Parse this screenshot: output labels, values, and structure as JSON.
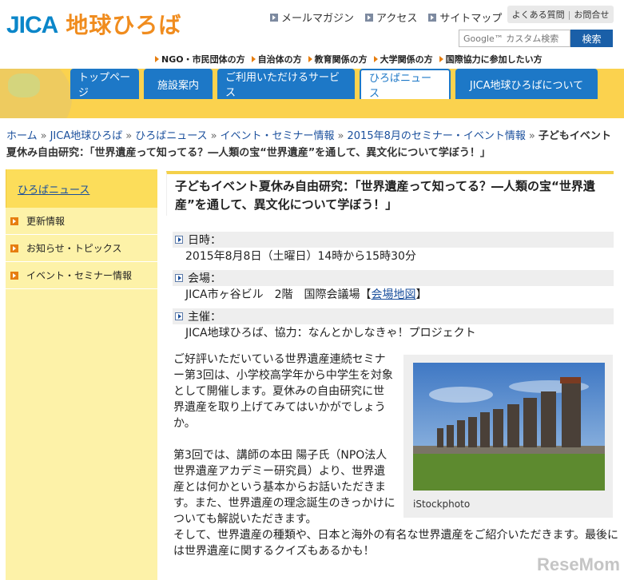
{
  "header": {
    "logo_en": "JICA",
    "logo_ja": "地球ひろば",
    "util_links": [
      "メールマガジン",
      "アクセス",
      "サイトマップ"
    ],
    "help": "よくある質問",
    "contact": "お問合せ",
    "search_placeholder": "Google™ カスタム検索",
    "search_button": "検索",
    "audience": [
      "NGO・市民団体の方",
      "自治体の方",
      "教育関係の方",
      "大学関係の方",
      "国際協力に参加したい方"
    ]
  },
  "nav": {
    "tabs": [
      "トップページ",
      "施設案内",
      "ご利用いただけるサービス",
      "ひろばニュース",
      "JICA地球ひろばについて"
    ],
    "active": "ひろばニュース"
  },
  "breadcrumb": {
    "items": [
      "ホーム",
      "JICA地球ひろば",
      "ひろばニュース",
      "イベント・セミナー情報",
      "2015年8月のセミナー・イベント情報"
    ],
    "current": "子どもイベント夏休み自由研究：「世界遺産って知ってる？―人類の宝“世界遺産”を通して、異文化について学ぼう！」"
  },
  "sidebar": {
    "title": "ひろばニュース",
    "items": [
      "更新情報",
      "お知らせ・トピックス",
      "イベント・セミナー情報"
    ]
  },
  "article": {
    "title": "子どもイベント夏休み自由研究：「世界遺産って知ってる？―人類の宝“世界遺産”を通して、異文化について学ぼう！」",
    "date_label": "日時：",
    "date_value": "2015年8月8日（土曜日）14時から15時30分",
    "venue_label": "会場：",
    "venue_value": "JICA市ヶ谷ビル　2階　国際会議場【",
    "venue_link": "会場地図",
    "venue_close": "】",
    "host_label": "主催：",
    "host_value": "JICA地球ひろば、協力：なんとかしなきゃ！プロジェクト",
    "para1": "ご好評いただいている世界遺産連続セミナー第3回は、小学校高学年から中学生を対象として開催します。夏休みの自由研究に世界遺産を取り上げてみてはいかがでしょうか。",
    "para2": "第3回では、講師の本田 陽子氏（NPO法人世界遺産アカデミー研究員）より、世界遺産とは何かという基本からお話いただきます。また、世界遺産の理念誕生のきっかけについても解説いただきます。",
    "para2_wide": "そして、世界遺産の種類や、日本と海外の有名な世界遺産をご紹介いただきます。最後には世界遺産に関するクイズもあるかも！",
    "photo_caption": "iStockphoto"
  },
  "watermark": "ReseMom"
}
